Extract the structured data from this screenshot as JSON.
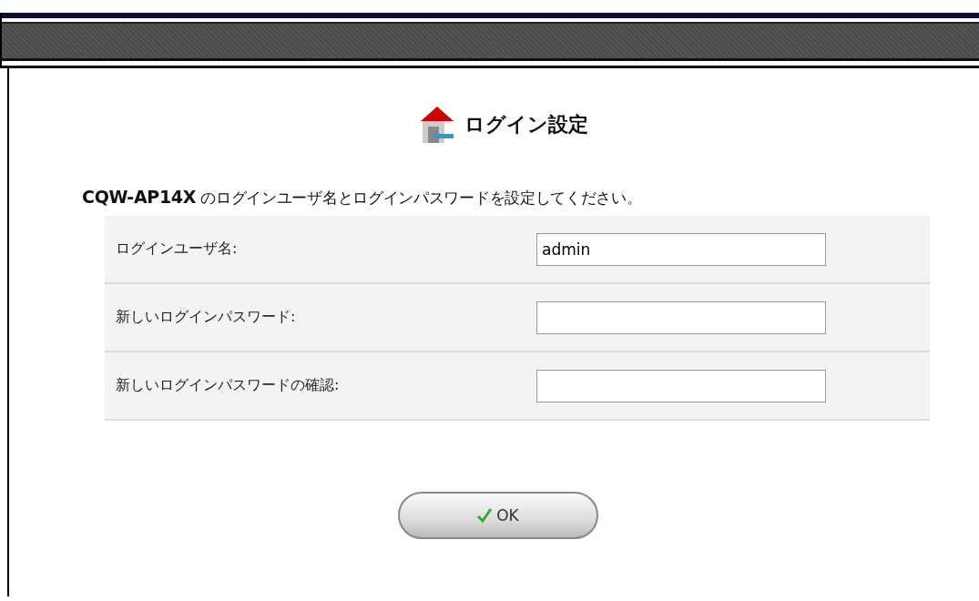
{
  "title": "ログイン設定",
  "description": "**CQW-AP14X** のログインユーザ名とログインパスワードを設定してください。",
  "fields": [
    {
      "label": "ログインユーザ名:",
      "value": "admin"
    },
    {
      "label": "新しいログインパスワード:"
    },
    {
      "label": "新しいログインパスワードの確認:"
    }
  ],
  "buttons": [
    {
      "label": "OK"
    }
  ]
}
